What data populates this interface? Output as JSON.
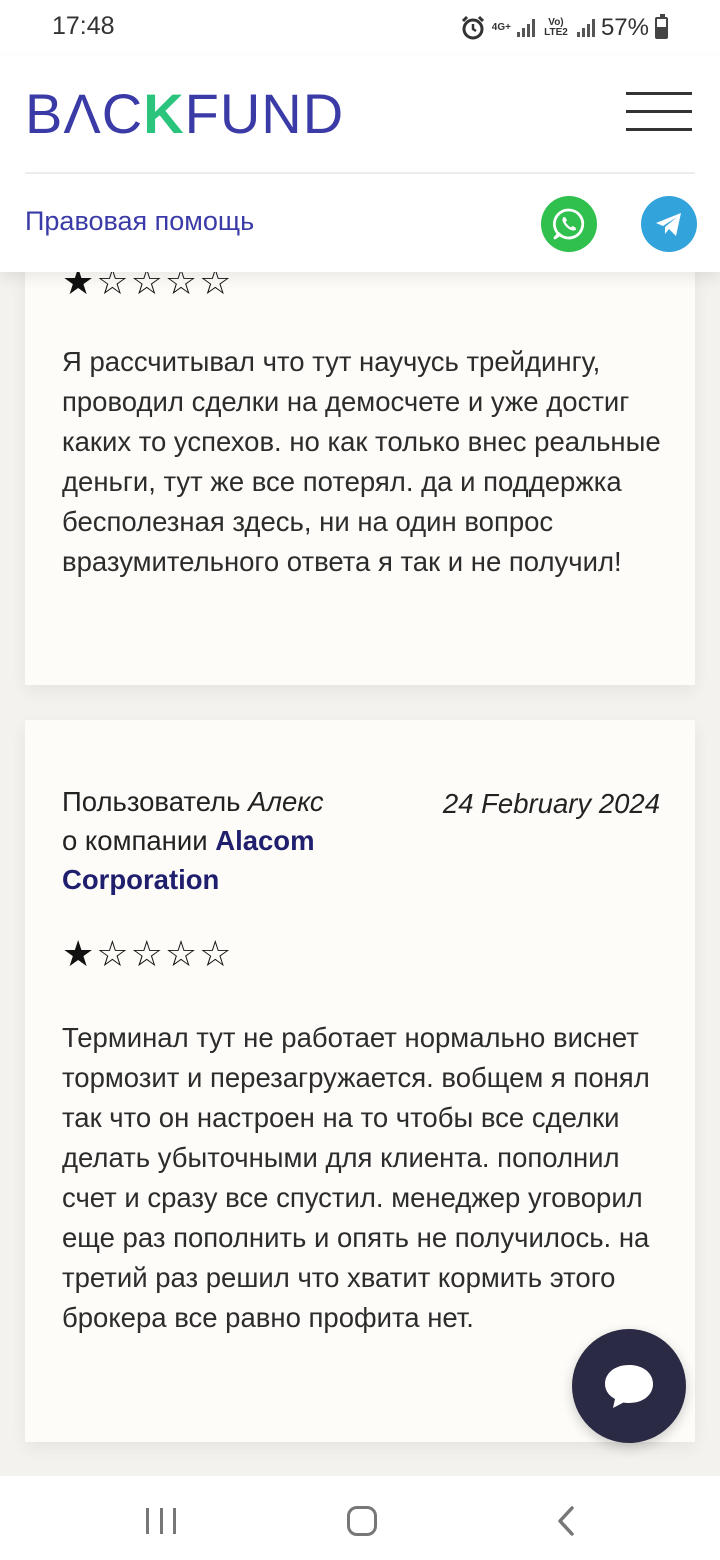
{
  "status_bar": {
    "time": "17:48",
    "network_1_label": "4G+",
    "network_2_label": "Vo) LTE2",
    "battery_text": "57%",
    "battery_level": 0.57,
    "icons": [
      "alarm-icon",
      "signal-icon",
      "battery-icon"
    ]
  },
  "header": {
    "logo_part1": "BΛC",
    "logo_part2": "K",
    "logo_part3": "FUND",
    "logo_colors": {
      "main": "#3b3ba8",
      "accent": "#2bc47d"
    },
    "legal_help_label": "Правовая помощь",
    "icons": [
      "menu-icon",
      "whatsapp-icon",
      "telegram-icon"
    ]
  },
  "reviews": [
    {
      "rating": 1,
      "max_rating": 5,
      "text": "Я рассчитывал что тут научусь трейдингу, проводил сделки на демосчете и уже достиг каких то успехов. но как только внес реальные деньги, тут же все потерял. да и поддержка бесполезная здесь, ни на один вопрос вразумительного ответа я так и не получил!"
    },
    {
      "author_prefix": "Пользователь",
      "author_name": "Алекс",
      "company_prefix": "о компании",
      "company_name": "Alacom Corporation",
      "date": "24 February 2024",
      "rating": 1,
      "max_rating": 5,
      "text": "Терминал тут не работает нормально виснет тормозит и перезагружается. вобщем я понял так что он настроен на то чтобы все сделки делать убыточными для клиента. пополнил счет и сразу все спустил. менеджер уговорил еще раз пополнить и опять не получилось. на третий раз решил что хватит кормить этого брокера все равно профита нет."
    }
  ],
  "chat": {
    "icon": "chat-bubble-icon",
    "color": "#2b2a44"
  },
  "nav_bar": {
    "icons": [
      "recents-icon",
      "home-icon",
      "back-icon"
    ]
  }
}
